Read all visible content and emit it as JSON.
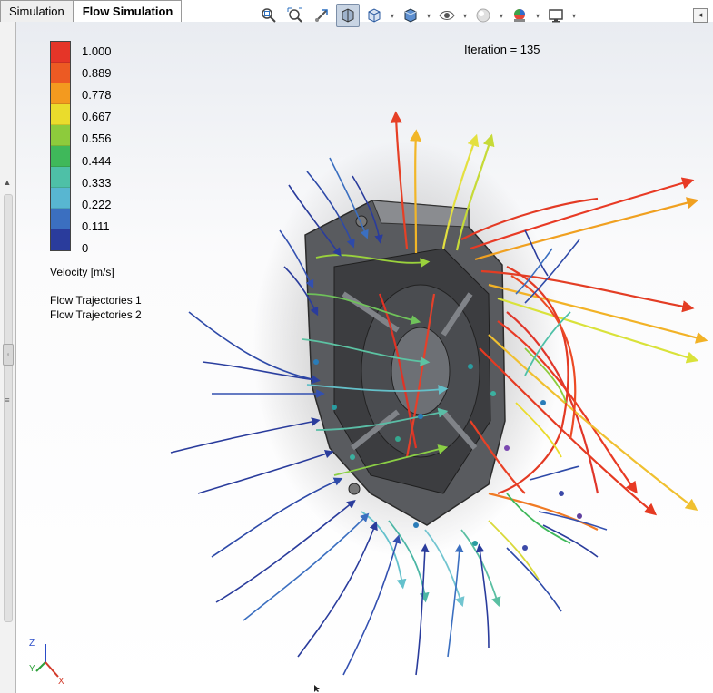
{
  "tabs": [
    {
      "label": "Simulation",
      "active": false
    },
    {
      "label": "Flow Simulation",
      "active": true
    }
  ],
  "toolbar": {
    "buttons": [
      {
        "icon": "zoom-to-fit-icon"
      },
      {
        "icon": "zoom-to-area-icon"
      },
      {
        "icon": "previous-view-icon"
      },
      {
        "icon": "section-view-icon",
        "pressed": true
      },
      {
        "icon": "view-orientation-icon",
        "has_menu": true
      },
      {
        "icon": "display-style-icon",
        "has_menu": true
      },
      {
        "icon": "hide-show-items-icon",
        "has_menu": true
      },
      {
        "icon": "edit-appearance-icon",
        "has_menu": true
      },
      {
        "icon": "apply-scene-icon",
        "has_menu": true
      },
      {
        "icon": "view-settings-icon",
        "has_menu": true
      }
    ],
    "collapse_glyph": "◂"
  },
  "iteration_label": "Iteration = 135",
  "legend": {
    "ticks": [
      "1.000",
      "0.889",
      "0.778",
      "0.667",
      "0.556",
      "0.444",
      "0.333",
      "0.222",
      "0.111",
      "0"
    ],
    "colors": [
      "#e53528",
      "#ec5a23",
      "#f39a1f",
      "#eadc2c",
      "#8dcb3c",
      "#3fb85a",
      "#4ec0a7",
      "#58b6d1",
      "#3b6fc0",
      "#2a3c9c"
    ],
    "quantity": "Velocity [m/s]",
    "trajectories": [
      "Flow Trajectories 1",
      "Flow Trajectories 2"
    ]
  },
  "triad": {
    "z": "Z",
    "y": "Y",
    "x": "X"
  }
}
